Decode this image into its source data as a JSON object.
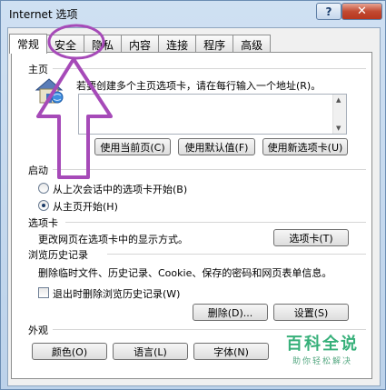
{
  "window": {
    "title": "Internet 选项",
    "help_label": "?",
    "close_label": "✕"
  },
  "tabs": [
    {
      "label": "常规",
      "active": true
    },
    {
      "label": "安全",
      "active": false
    },
    {
      "label": "隐私",
      "active": false
    },
    {
      "label": "内容",
      "active": false
    },
    {
      "label": "连接",
      "active": false
    },
    {
      "label": "程序",
      "active": false
    },
    {
      "label": "高级",
      "active": false
    }
  ],
  "homepage": {
    "section_label": "主页",
    "description": "若要创建多个主页选项卡，请在每行输入一个地址(R)。",
    "address_value": "",
    "btn_current": "使用当前页(C)",
    "btn_default": "使用默认值(F)",
    "btn_newtab": "使用新选项卡(U)",
    "icon": "home-icon"
  },
  "startup": {
    "section_label": "启动",
    "option_last": "从上次会话中的选项卡开始(B)",
    "option_home": "从主页开始(H)",
    "selected": "option_home"
  },
  "tabs_section": {
    "section_label": "选项卡",
    "description": "更改网页在选项卡中的显示方式。",
    "btn_tabs": "选项卡(T)"
  },
  "history": {
    "section_label": "浏览历史记录",
    "description": "删除临时文件、历史记录、Cookie、保存的密码和网页表单信息。",
    "checkbox_label": "退出时删除浏览历史记录(W)",
    "checkbox_checked": false,
    "btn_delete": "删除(D)...",
    "btn_settings": "设置(S)"
  },
  "appearance": {
    "section_label": "外观",
    "btn_colors": "颜色(O)",
    "btn_languages": "语言(L)",
    "btn_fonts": "字体(N)"
  },
  "watermark": {
    "main": "百科全说",
    "sub": "助你轻松解决"
  },
  "colors": {
    "annotation": "#a64ab8",
    "watermark": "#37b07a"
  }
}
